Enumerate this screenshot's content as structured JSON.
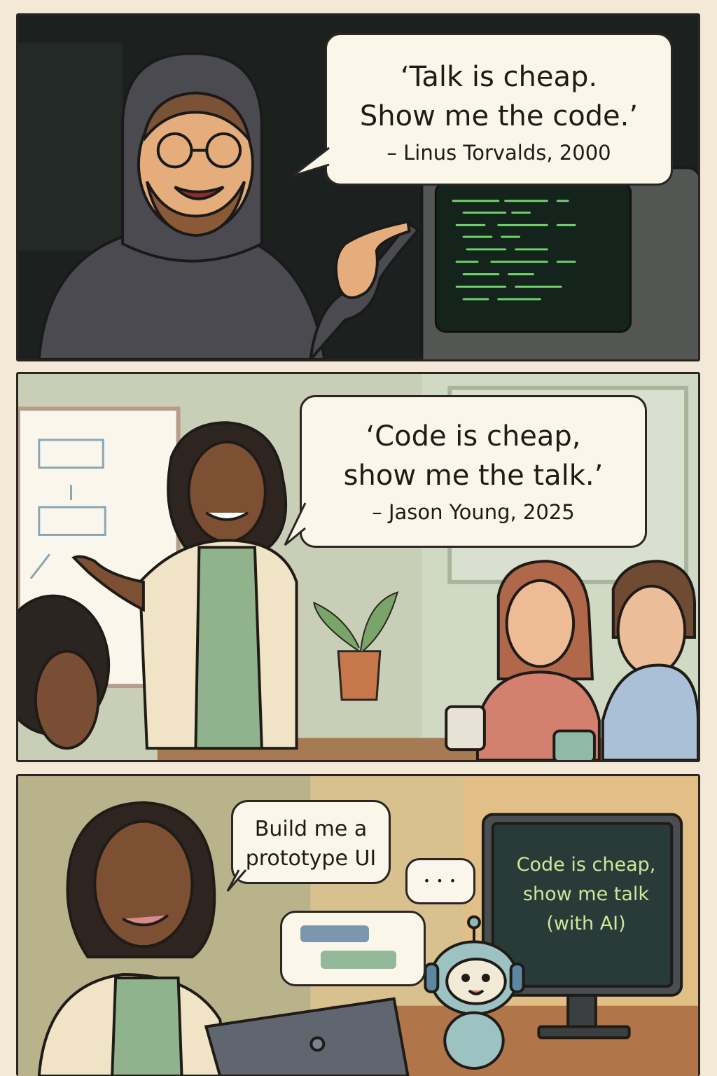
{
  "panel1": {
    "quote": "‘Talk is cheap.\nShow me the code.’",
    "attribution": "– Linus Torvalds, 2000"
  },
  "panel2": {
    "quote": "‘Code is cheap,\nshow me the talk.’",
    "attribution": "– Jason Young, 2025"
  },
  "panel3": {
    "request_bubble": "Build me a\nprototype UI",
    "thinking_bubble": "• • •",
    "monitor_text": "Code is cheap,\nshow me talk\n(with AI)"
  },
  "colors": {
    "background": "#f3e9d6",
    "outline": "#2b2622",
    "terminal_green": "#6fd36a",
    "monitor_text": "#cfe79a"
  }
}
